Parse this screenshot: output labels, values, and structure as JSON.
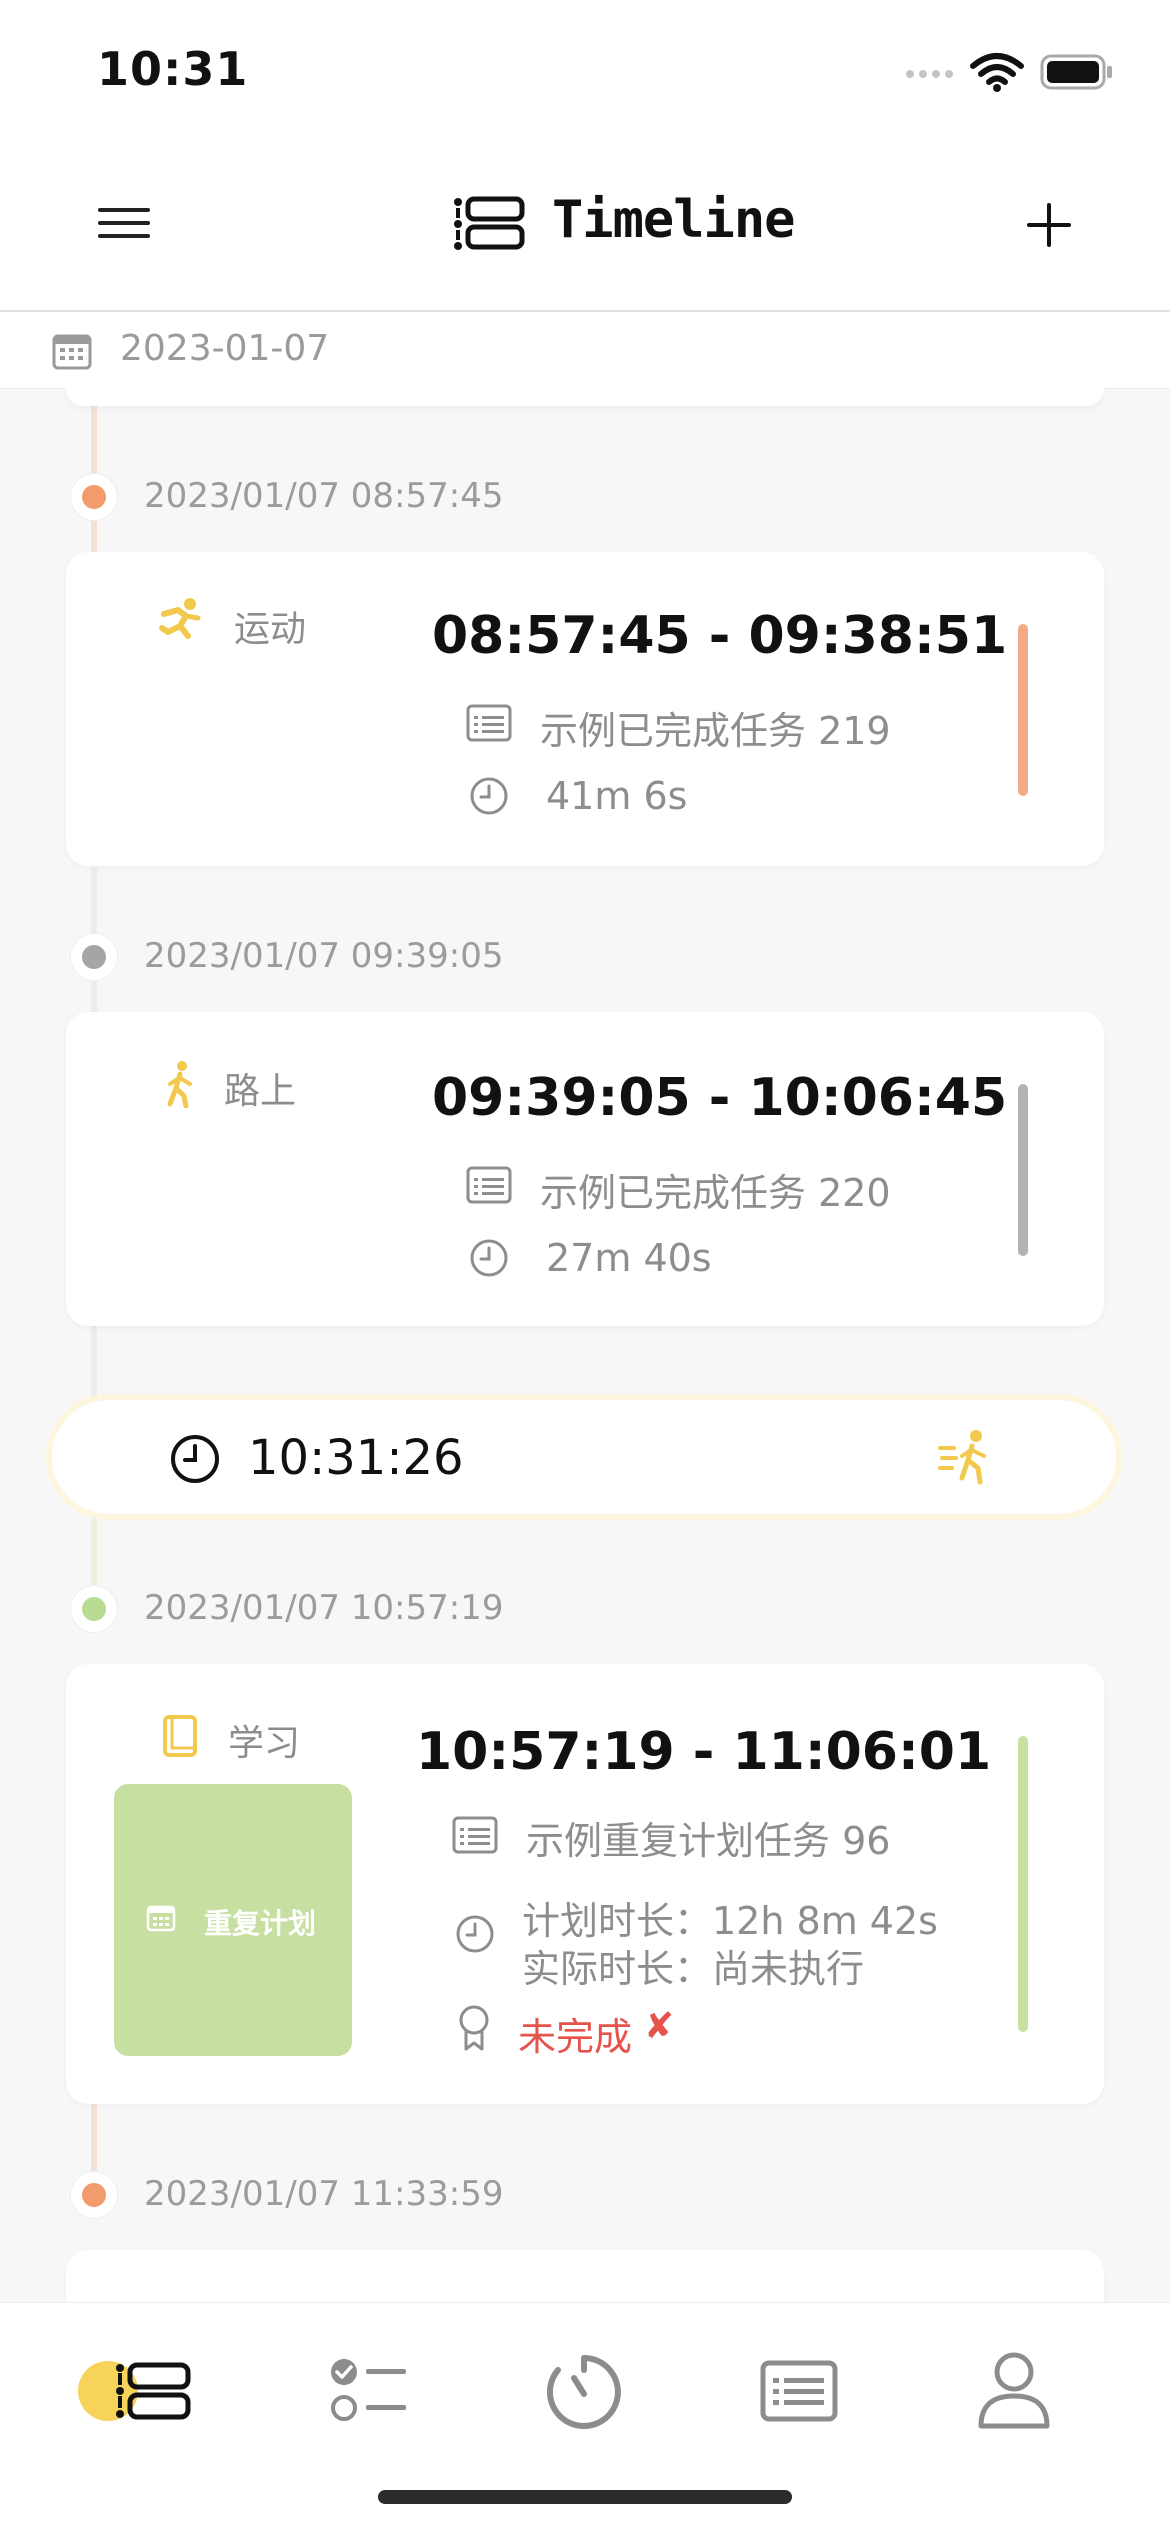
{
  "status_bar": {
    "time": "10:31"
  },
  "nav": {
    "title": "Timeline"
  },
  "date_bar": {
    "date": "2023-01-07"
  },
  "entries": [
    {
      "timestamp": "2023/01/07 08:57:45",
      "dot_color": "#f39b6d",
      "category": "运动",
      "time_range": "08:57:45 - 09:38:51",
      "task": "示例已完成任务 219",
      "duration": "41m 6s",
      "bar_color": "#f3ab85"
    },
    {
      "timestamp": "2023/01/07 09:39:05",
      "dot_color": "#a5a5a5",
      "category": "路上",
      "time_range": "09:39:05 - 10:06:45",
      "task": "示例已完成任务 220",
      "duration": "27m 40s",
      "bar_color": "#b3b3b3"
    },
    {
      "timestamp": "2023/01/07 10:57:19",
      "dot_color": "#b7dc92",
      "category": "学习",
      "time_range": "10:57:19 - 11:06:01",
      "task": "示例重复计划任务 96",
      "planned_duration": "计划时长：12h 8m 42s",
      "actual_duration": "实际时长：尚未执行",
      "status": "未完成",
      "status_mark": "✘",
      "plan_badge": "重复计划",
      "bar_color": "#c7e0a2"
    },
    {
      "timestamp": "2023/01/07 11:33:59",
      "dot_color": "#f39b6d"
    }
  ],
  "current_timer": {
    "time": "10:31:26"
  },
  "tabs": [
    {
      "name": "timeline",
      "active": true
    },
    {
      "name": "tasks"
    },
    {
      "name": "timer"
    },
    {
      "name": "records"
    },
    {
      "name": "profile"
    }
  ],
  "colors": {
    "accent_yellow": "#f7d35a",
    "incomplete_red": "#e5534b"
  }
}
